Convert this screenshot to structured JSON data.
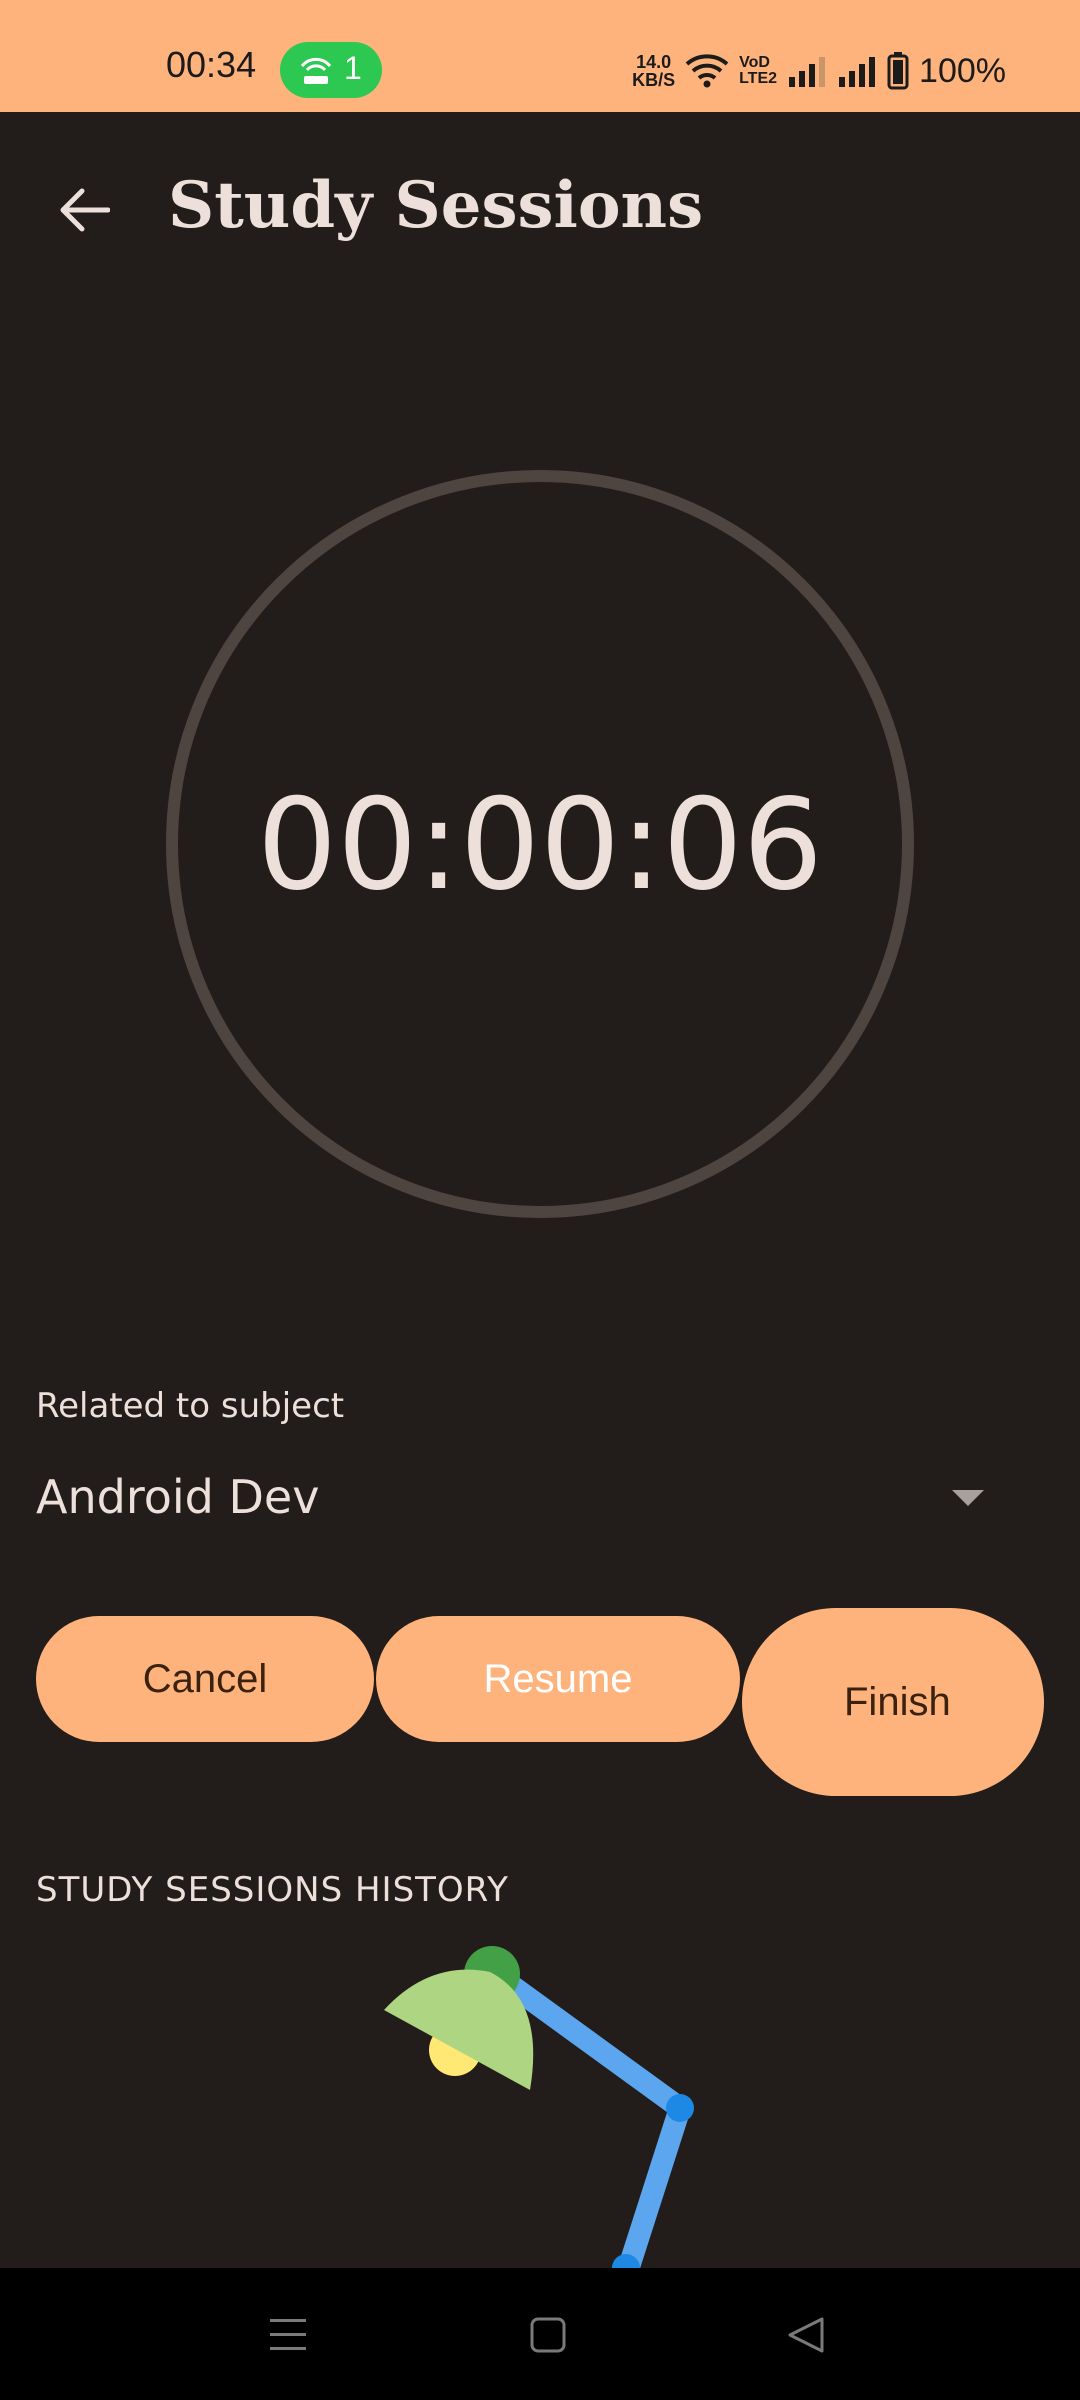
{
  "status_bar": {
    "time": "00:34",
    "hotspot_count": "1",
    "net_speed_value": "14.0",
    "net_speed_unit": "KB/S",
    "volte_top": "VoD",
    "volte_bottom": "LTE2",
    "battery": "100%",
    "background": "#FFB37C"
  },
  "app_bar": {
    "title": "Study Sessions"
  },
  "timer": {
    "display": "00:00:06"
  },
  "subject": {
    "label": "Related to subject",
    "value": "Android Dev"
  },
  "buttons": {
    "cancel": "Cancel",
    "resume": "Resume",
    "finish": "Finish"
  },
  "history": {
    "title": "STUDY SESSIONS HISTORY"
  },
  "colors": {
    "background": "#221D1A",
    "accent": "#FFB37C",
    "ring": "#4F4540",
    "text": "#EDE0DA"
  }
}
